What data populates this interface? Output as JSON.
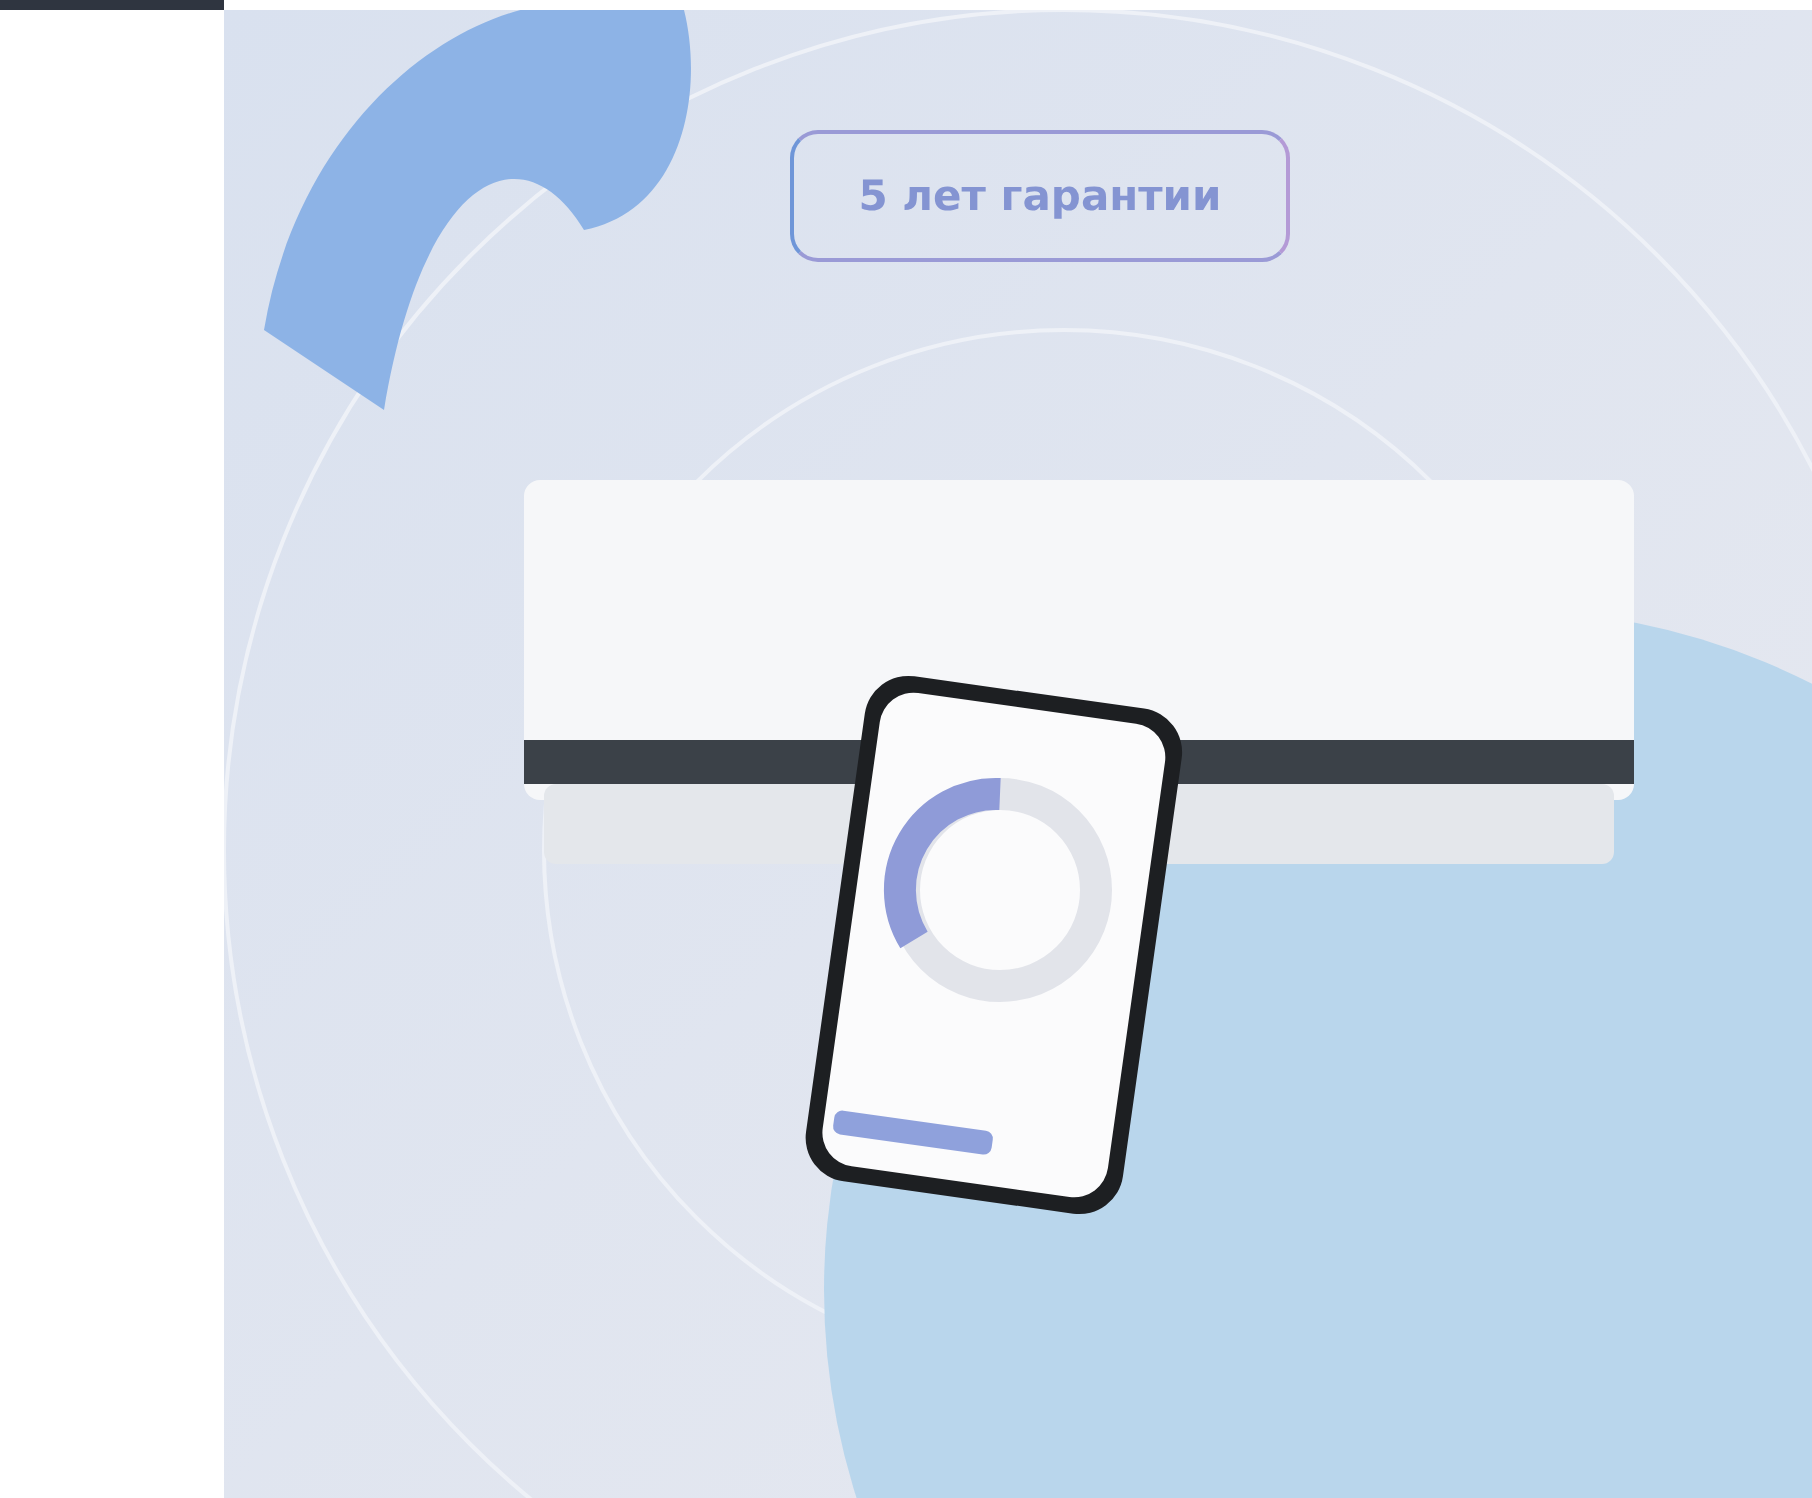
{
  "banner": {
    "kind": "picture",
    "badge": "5 лет гарантии"
  }
}
